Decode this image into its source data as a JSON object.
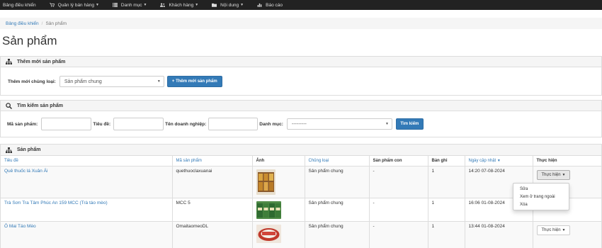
{
  "nav": {
    "items": [
      {
        "label": "Bảng điều khiển",
        "caret": false,
        "icon": "dashboard-icon"
      },
      {
        "label": "Quản lý bán hàng",
        "caret": true,
        "icon": "cart-icon"
      },
      {
        "label": "Danh mục",
        "caret": true,
        "icon": "list-icon"
      },
      {
        "label": "Khách hàng",
        "caret": true,
        "icon": "users-icon"
      },
      {
        "label": "Nội dung",
        "caret": true,
        "icon": "folder-icon"
      },
      {
        "label": "Báo cáo",
        "caret": false,
        "icon": "chart-icon"
      }
    ]
  },
  "breadcrumb": {
    "home": "Bảng điều khiển",
    "current": "Sản phẩm"
  },
  "page": {
    "title": "Sản phẩm"
  },
  "add_panel": {
    "title": "Thêm mới sản phẩm",
    "type_label": "Thêm mới chủng loại:",
    "type_value": "Sản phẩm chung",
    "add_button": "+ Thêm mới sản phẩm"
  },
  "search_panel": {
    "title": "Tìm kiếm sản phẩm",
    "code_label": "Mã sản phẩm:",
    "title_label": "Tiêu đề:",
    "company_label": "Tên doanh nghiệp:",
    "category_label": "Danh mục:",
    "category_value": "---------",
    "search_button": "Tìm kiếm"
  },
  "list_panel": {
    "title": "Sản phẩm",
    "columns": [
      "Tiêu đề",
      "Mã sản phẩm",
      "Ảnh",
      "Chủng loại",
      "Sản phẩm con",
      "Bản ghi",
      "Ngày cập nhật",
      "Thực hiện"
    ],
    "rows": [
      {
        "title": "Quê thuốc lá Xuân Ái",
        "code": "quethuoclaxuanai",
        "type": "Sản phẩm chung",
        "children": "-",
        "records": "1",
        "updated": "14:20 07-08-2024",
        "action": "Thực hiện"
      },
      {
        "title": "Trà Sơn Tra Tâm Phúc An 159 MCC (Trà táo mèo)",
        "code": "MCC 5",
        "type": "Sản phẩm chung",
        "children": "-",
        "records": "1",
        "updated": "16:06 01-08-2024",
        "action": "Thực hiện"
      },
      {
        "title": "Ô Mai Táo Mèo",
        "code": "OmaitaomeoDL",
        "type": "Sản phẩm chung",
        "children": "-",
        "records": "1",
        "updated": "13:44 01-08-2024",
        "action": "Thực hiện"
      }
    ]
  },
  "dropdown_menu": {
    "items": [
      "Sửa",
      "Xem ở trang ngoài",
      "Xóa"
    ]
  },
  "colors": {
    "navbar": "#222222",
    "link": "#337ab7",
    "primary": "#337ab7"
  }
}
